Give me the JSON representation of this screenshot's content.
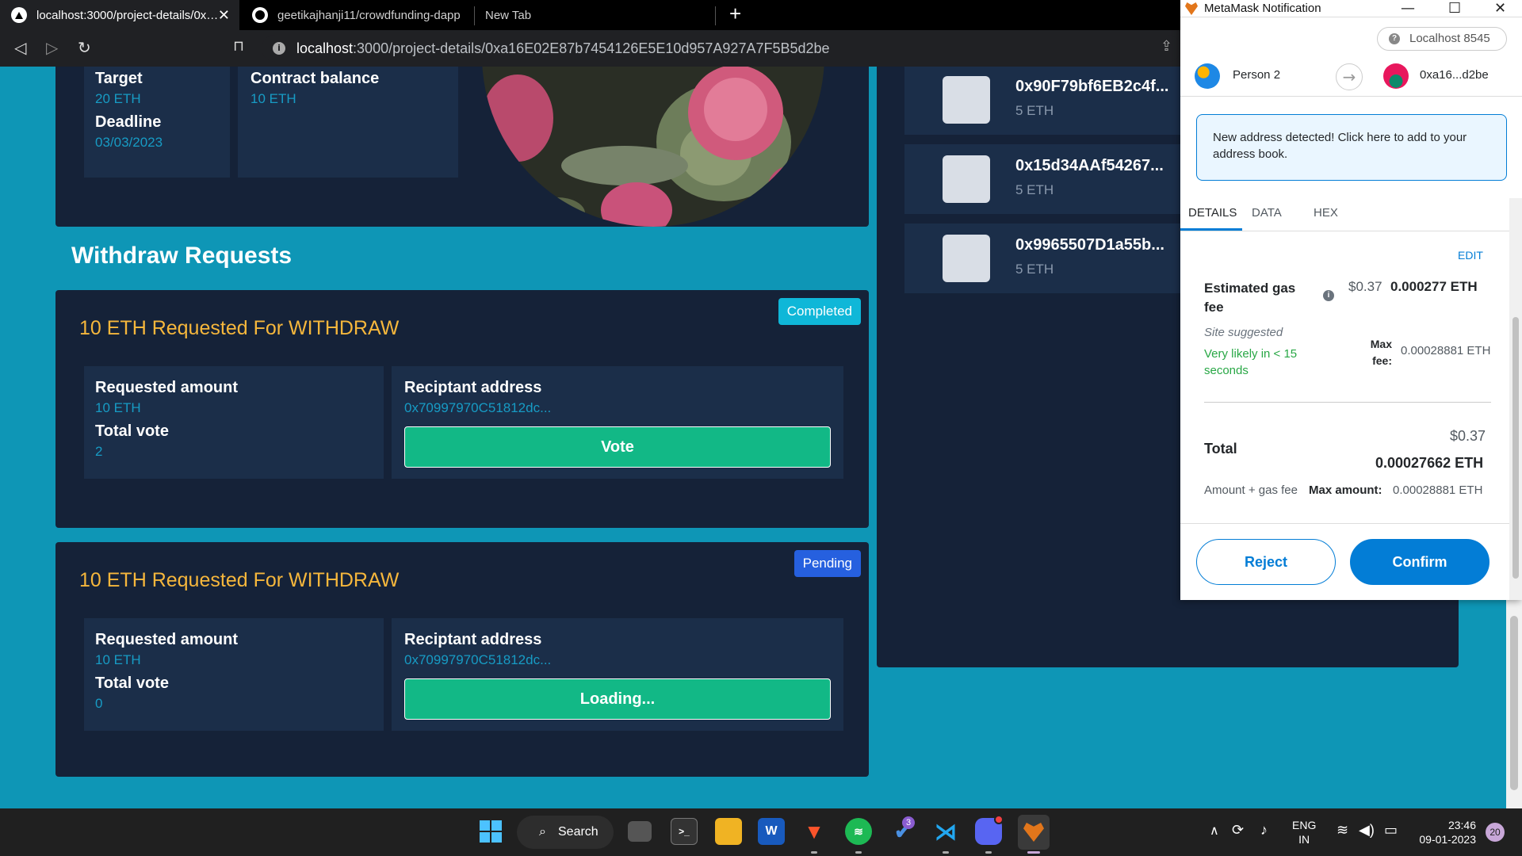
{
  "browser": {
    "tabs": [
      {
        "title": "localhost:3000/project-details/0x…",
        "active": true
      },
      {
        "title": "geetikajhanji11/crowdfunding-dapp",
        "active": false
      },
      {
        "title": "New Tab",
        "active": false
      }
    ],
    "new_tab_label": "+",
    "close_label": "✕",
    "url_host": "localhost",
    "url_rest": ":3000/project-details/0xa16E02E87b7454126E5E10d957A927A7F5B5d2be"
  },
  "project": {
    "target_label": "Target",
    "target_value": "20 ETH",
    "deadline_label": "Deadline",
    "deadline_value": "03/03/2023",
    "balance_label": "Contract balance",
    "balance_value": "10 ETH"
  },
  "withdraw": {
    "section_title": "Withdraw Requests",
    "requests": [
      {
        "title": "10 ETH Requested For WITHDRAW",
        "status": "Completed",
        "amount_label": "Requested amount",
        "amount_value": "10 ETH",
        "vote_label": "Total vote",
        "vote_value": "2",
        "address_label": "Reciptant address",
        "address_value": "0x70997970C51812dc...",
        "button_label": "Vote"
      },
      {
        "title": "10 ETH Requested For WITHDRAW",
        "status": "Pending",
        "amount_label": "Requested amount",
        "amount_value": "10 ETH",
        "vote_label": "Total vote",
        "vote_value": "0",
        "address_label": "Reciptant address",
        "address_value": "0x70997970C51812dc...",
        "button_label": "Loading..."
      }
    ]
  },
  "contributors": [
    {
      "address": "0x90F79bf6EB2c4f...",
      "amount": "5 ETH"
    },
    {
      "address": "0x15d34AAf54267...",
      "amount": "5 ETH"
    },
    {
      "address": "0x9965507D1a55b...",
      "amount": "5 ETH"
    }
  ],
  "metamask": {
    "window_title": "MetaMask Notification",
    "network": "Localhost 8545",
    "from_account": "Person 2",
    "to_account": "0xa16...d2be",
    "notice": "New address detected! Click here to add to your address book.",
    "tabs": [
      "DETAILS",
      "DATA",
      "HEX"
    ],
    "edit_label": "EDIT",
    "gas_label": "Estimated gas fee",
    "gas_usd": "$0.37",
    "gas_eth": "0.000277 ETH",
    "site_suggested": "Site suggested",
    "likely_text": "Very likely in < 15 seconds",
    "max_fee_label": "Max fee:",
    "max_fee_value": "0.00028881 ETH",
    "total_usd": "$0.37",
    "total_label": "Total",
    "total_eth": "0.00027662 ETH",
    "amount_gas_label": "Amount + gas fee",
    "max_amount_label": "Max amount:",
    "max_amount_value": "0.00028881 ETH",
    "reject_label": "Reject",
    "confirm_label": "Confirm",
    "primary_color": "#037dd6"
  },
  "taskbar": {
    "search_label": "Search",
    "todo_badge": "3",
    "language_top": "ENG",
    "language_bottom": "IN",
    "time": "23:46",
    "date": "09-01-2023",
    "notifications_count": "20",
    "icons": [
      "windows-start-icon",
      "search-icon",
      "task-view-icon",
      "terminal-icon",
      "file-explorer-icon",
      "word-icon",
      "brave-icon",
      "spotify-icon",
      "todo-icon",
      "vscode-icon",
      "discord-icon",
      "metamask-icon"
    ]
  }
}
